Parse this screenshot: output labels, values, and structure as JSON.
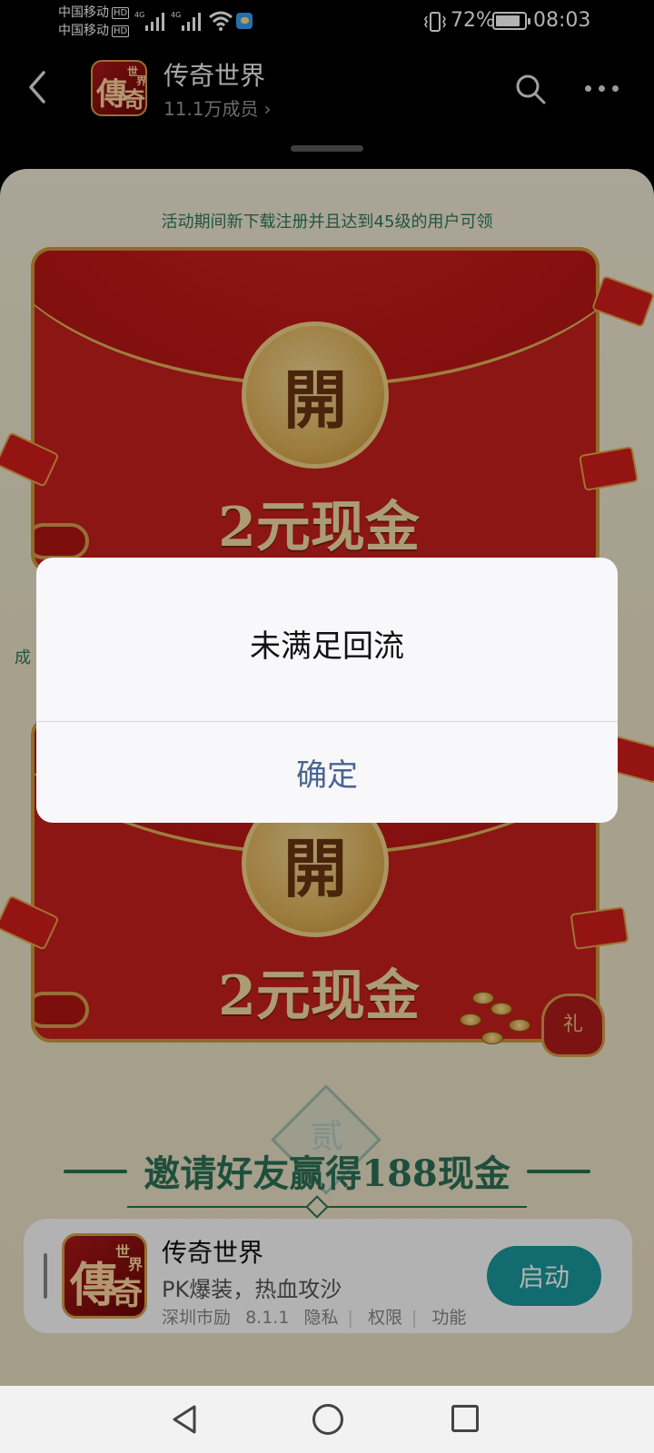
{
  "status_bar": {
    "carrier1": "中国移动",
    "carrier2": "中国移动",
    "hd": "HD",
    "net_tag": "4G",
    "battery": "72%",
    "time": "08:03"
  },
  "header": {
    "title": "传奇世界",
    "members": "11.1万成员",
    "chevron": "›"
  },
  "logo": {
    "glyph_main": "傳",
    "glyph_second": "奇",
    "glyph_small1": "世",
    "glyph_small2": "界"
  },
  "sheet": {
    "notice": "活动期间新下载注册并且达到45级的用户可领",
    "side_text": "成",
    "envelopes": [
      {
        "open_label": "開",
        "amount": "2元现金"
      },
      {
        "open_label": "開",
        "amount": "2元现金"
      }
    ],
    "gift_bag_label": "礼",
    "invite": {
      "number": "贰",
      "title": "邀请好友赢得188现金"
    }
  },
  "app_card": {
    "title": "传奇世界",
    "slogan": "PK爆装，热血攻沙",
    "developer": "深圳市励",
    "version": "8.1.1",
    "privacy": "隐私",
    "permissions": "权限",
    "features": "功能",
    "launch": "启动"
  },
  "dialog": {
    "message": "未满足回流",
    "confirm": "确定"
  },
  "colors": {
    "accent_green": "#2f7a5a",
    "envelope_red": "#c7201e",
    "gold": "#cf9a3c",
    "launch_teal": "#1a9a9e",
    "confirm_blue": "#4a6490"
  }
}
